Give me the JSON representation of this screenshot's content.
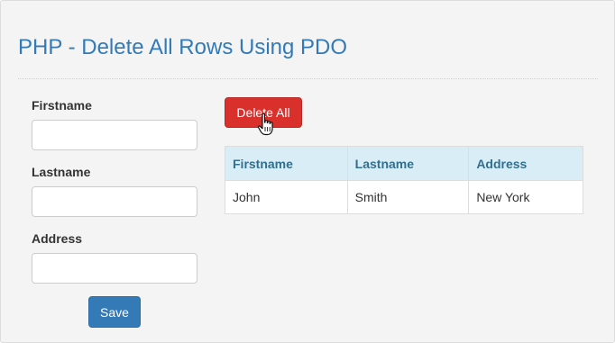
{
  "page": {
    "title": "PHP - Delete All Rows Using PDO"
  },
  "form": {
    "firstname_label": "Firstname",
    "firstname_value": "",
    "lastname_label": "Lastname",
    "lastname_value": "",
    "address_label": "Address",
    "address_value": "",
    "save_label": "Save"
  },
  "actions": {
    "delete_all_label": "Delete All"
  },
  "table": {
    "headers": [
      "Firstname",
      "Lastname",
      "Address"
    ],
    "rows": [
      [
        "John",
        "Smith",
        "New York"
      ]
    ]
  },
  "colors": {
    "title": "#337ab7",
    "delete_button": "#d9302c",
    "save_button": "#337ab7",
    "table_header_bg": "#d9edf7",
    "table_header_text": "#31708f"
  },
  "icons": {
    "cursor": "hand-pointer-icon"
  }
}
